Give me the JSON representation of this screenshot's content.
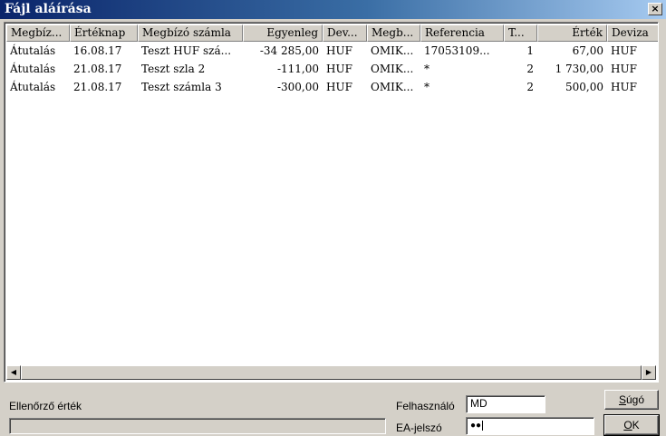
{
  "window": {
    "title": "Fájl aláírása",
    "close_glyph": "×"
  },
  "grid": {
    "columns": [
      {
        "label": "Megbíz...",
        "align": "left"
      },
      {
        "label": "Értéknap",
        "align": "left"
      },
      {
        "label": "Megbízó számla",
        "align": "left"
      },
      {
        "label": "Egyenleg",
        "align": "right"
      },
      {
        "label": "Dev...",
        "align": "left"
      },
      {
        "label": "Megb...",
        "align": "left"
      },
      {
        "label": "Referencia",
        "align": "left"
      },
      {
        "label": "T...",
        "align": "left"
      },
      {
        "label": "Érték",
        "align": "right"
      },
      {
        "label": "Deviza",
        "align": "left"
      }
    ],
    "rows": [
      [
        "Átutalás",
        "16.08.17",
        "Teszt HUF szá...",
        "-34 285,00",
        "HUF",
        "OMIK...",
        "17053109...",
        "1",
        "67,00",
        "HUF"
      ],
      [
        "Átutalás",
        "21.08.17",
        "Teszt szla 2",
        "-111,00",
        "HUF",
        "OMIK...",
        "*",
        "2",
        "1 730,00",
        "HUF"
      ],
      [
        "Átutalás",
        "21.08.17",
        "Teszt számla  3",
        "-300,00",
        "HUF",
        "OMIK...",
        "*",
        "2",
        "500,00",
        "HUF"
      ]
    ],
    "scroll_left_glyph": "◀",
    "scroll_right_glyph": "▶"
  },
  "footer": {
    "checksum_label": "Ellenőrző érték",
    "checksum_value": "",
    "user_label": "Felhasználó",
    "user_value": "MD",
    "password_label": "EA-jelszó",
    "password_value": "●●"
  },
  "buttons": {
    "help_label_underlined": "S",
    "help_label_rest": "úgó",
    "ok_label_underlined": "O",
    "ok_label_rest": "K"
  }
}
